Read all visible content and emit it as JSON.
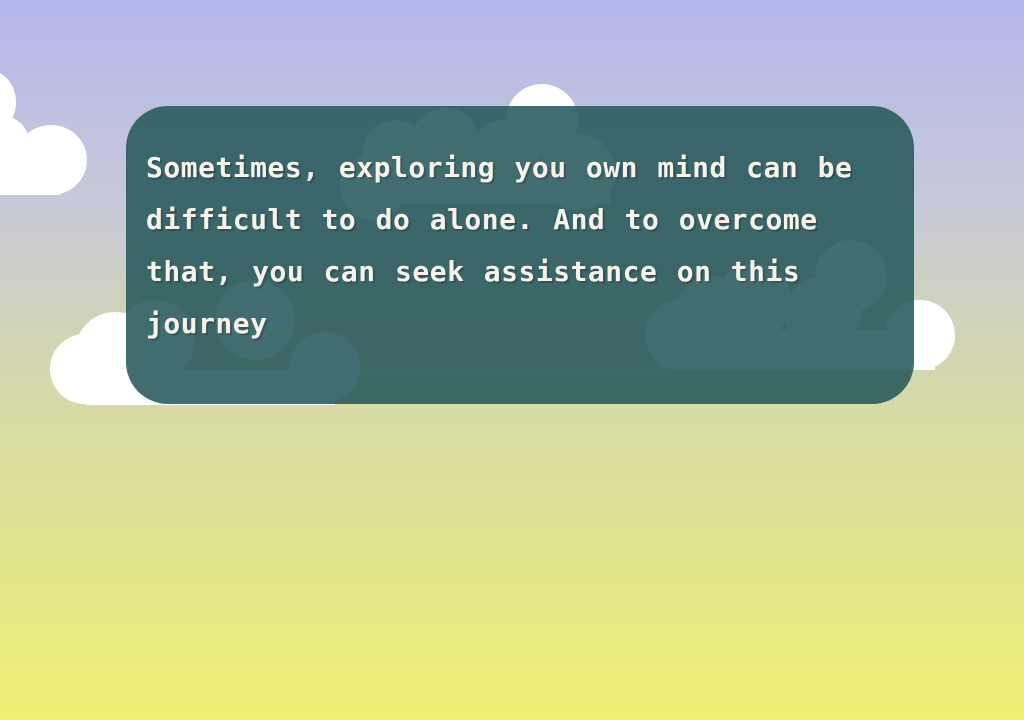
{
  "dialog": {
    "text": "Sometimes, exploring you own mind can be difficult to do alone. And to overcome that, you can seek assistance on this journey"
  },
  "colors": {
    "sky_top": "#b3b6ed",
    "sky_bottom": "#eef073",
    "dialog_bg": "#235559",
    "dialog_text": "#f5f3ea",
    "cloud": "#ffffff"
  }
}
